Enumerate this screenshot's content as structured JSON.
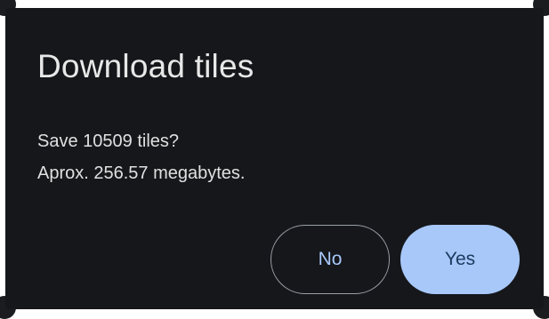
{
  "dialog": {
    "title": "Download tiles",
    "message_line1": "Save 10509 tiles?",
    "message_line2": "Aprox. 256.57 megabytes.",
    "buttons": {
      "no_label": "No",
      "yes_label": "Yes"
    }
  },
  "colors": {
    "dialog_background": "#15171b",
    "title_text": "#e8e8e8",
    "body_text": "#e0e0e0",
    "accent": "#a8c8fa",
    "outline": "#9aa0a6"
  }
}
